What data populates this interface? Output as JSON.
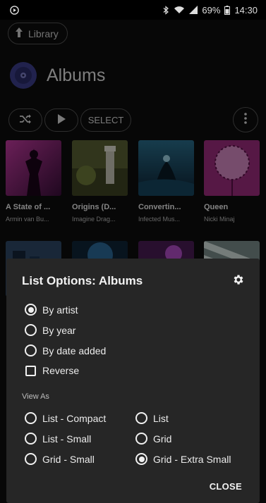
{
  "status_bar": {
    "battery": "69%",
    "time": "14:30"
  },
  "header": {
    "library_label": "Library",
    "title": "Albums",
    "select_label": "SELECT"
  },
  "albums": [
    {
      "title": "A State of ...",
      "artist": "Armin van Bu..."
    },
    {
      "title": "Origins (D...",
      "artist": "Imagine Drag..."
    },
    {
      "title": "Convertin...",
      "artist": "Infected Mus..."
    },
    {
      "title": "Queen",
      "artist": "Nicki Minaj"
    }
  ],
  "dialog": {
    "title": "List Options: Albums",
    "sort_options": [
      "By artist",
      "By year",
      "By date added"
    ],
    "selected_sort": "By artist",
    "reverse_label": "Reverse",
    "reverse_checked": false,
    "view_as_label": "View As",
    "view_options": [
      "List - Compact",
      "List",
      "List - Small",
      "Grid",
      "Grid - Small",
      "Grid - Extra Small"
    ],
    "selected_view": "Grid - Extra Small",
    "close_label": "CLOSE"
  },
  "colors": {
    "accent_logo": "#3d3f8c",
    "dialog_bg": "#262626"
  }
}
